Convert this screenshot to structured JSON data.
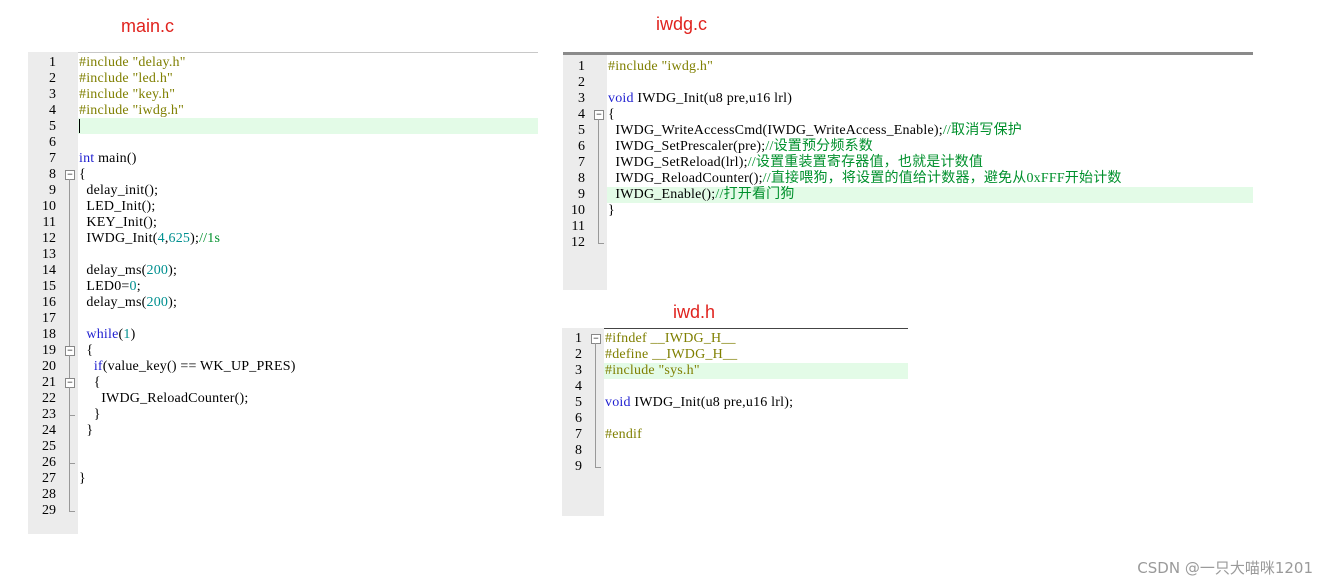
{
  "captions": {
    "main": "main.c",
    "iwdg": "iwdg.c",
    "iwdh": "iwd.h"
  },
  "main_c": {
    "lines": [
      "#include \"delay.h\"",
      "#include \"led.h\"",
      "#include \"key.h\"",
      "#include \"iwdg.h\"",
      "",
      "",
      "int main()",
      "{",
      "  delay_init();",
      "  LED_Init();",
      "  KEY_Init();",
      "  IWDG_Init(4,625);//1s",
      "",
      "  delay_ms(200);",
      "  LED0=0;",
      "  delay_ms(200);",
      "",
      "  while(1)",
      "  {",
      "    if(value_key() == WK_UP_PRES)",
      "    {",
      "      IWDG_ReloadCounter();",
      "    }",
      "  }",
      "",
      "",
      "}",
      "",
      ""
    ]
  },
  "iwdg_c": {
    "lines": [
      "#include \"iwdg.h\"",
      "",
      "void IWDG_Init(u8 pre,u16 lrl)",
      "{",
      "  IWDG_WriteAccessCmd(IWDG_WriteAccess_Enable);//取消写保护",
      "  IWDG_SetPrescaler(pre);//设置预分频系数",
      "  IWDG_SetReload(lrl);//设置重装置寄存器值，也就是计数值",
      "  IWDG_ReloadCounter();//直接喂狗，将设置的值给计数器，避免从0xFFF开始计数",
      "  IWDG_Enable();//打开看门狗",
      "}",
      "",
      ""
    ]
  },
  "iwd_h": {
    "lines": [
      "#ifndef __IWDG_H__",
      "#define __IWDG_H__",
      "#include \"sys.h\"",
      "",
      "void IWDG_Init(u8 pre,u16 lrl);",
      "",
      "#endif",
      "",
      ""
    ]
  },
  "watermark": "CSDN @一只大喵咪1201"
}
